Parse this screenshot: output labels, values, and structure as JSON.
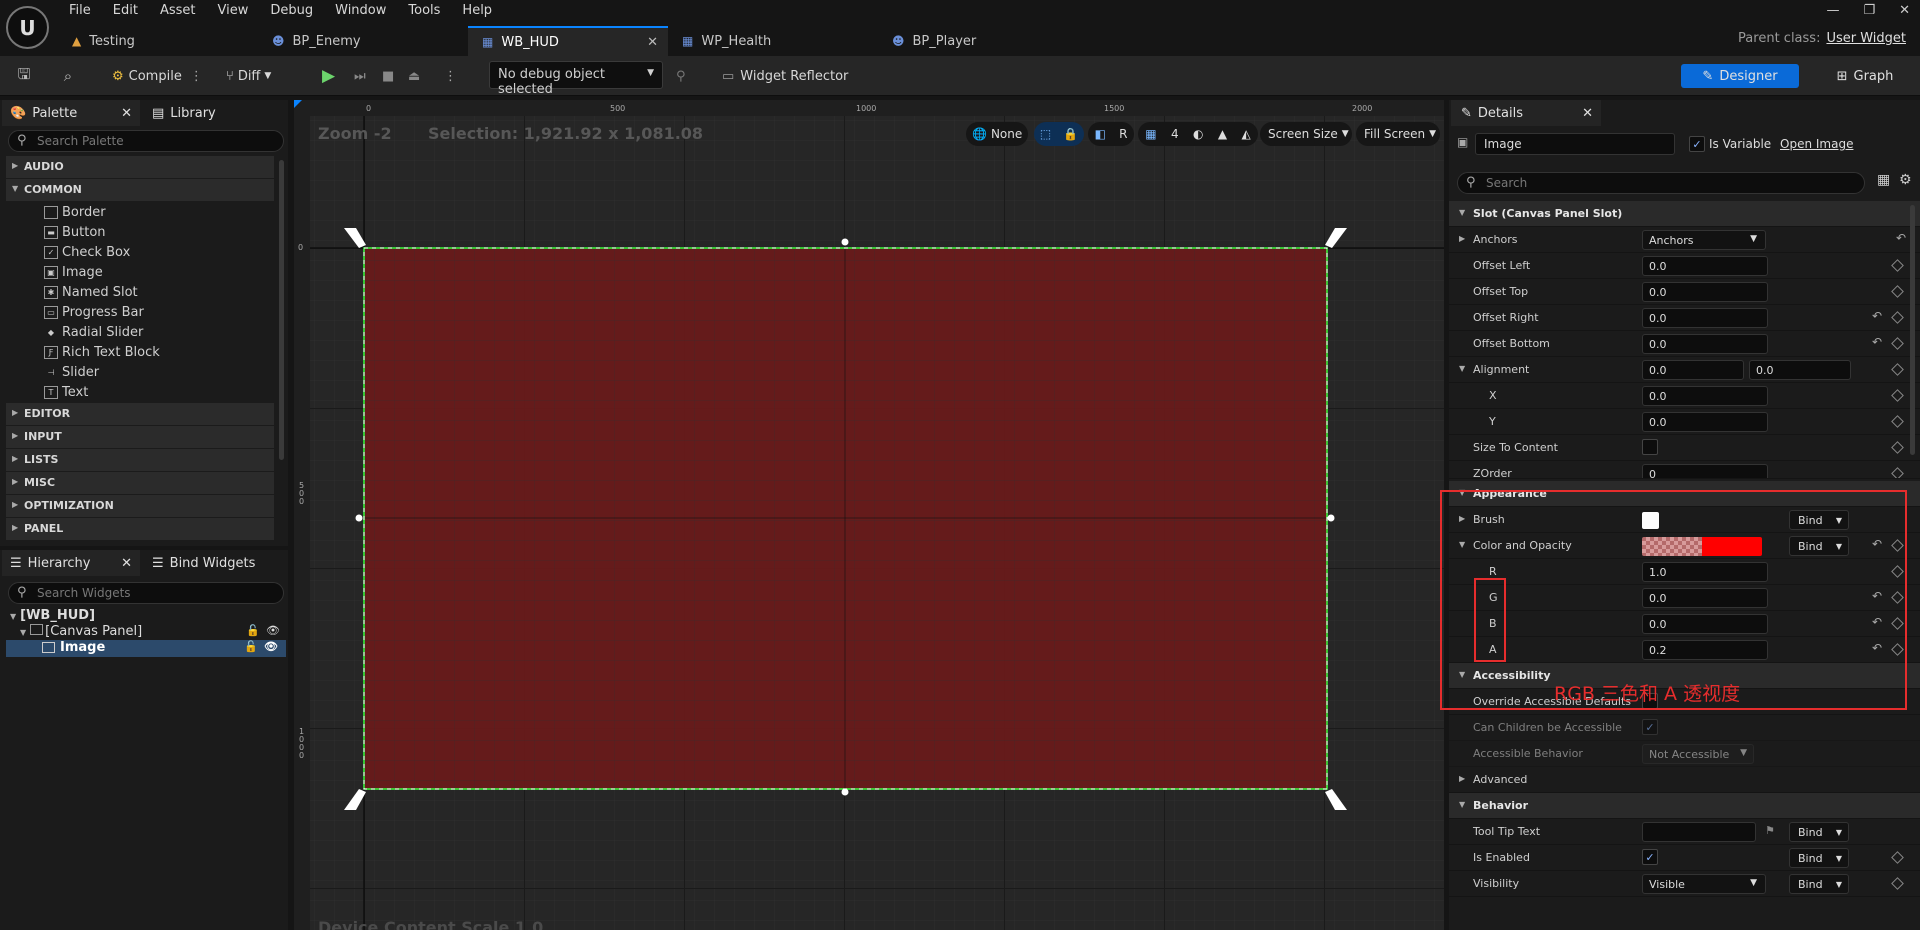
{
  "menu": [
    "File",
    "Edit",
    "Asset",
    "View",
    "Debug",
    "Window",
    "Tools",
    "Help"
  ],
  "tabs": [
    {
      "label": "Testing",
      "icon": "ue-icon",
      "active": false
    },
    {
      "label": "BP_Enemy",
      "icon": "person-icon",
      "active": false
    },
    {
      "label": "WB_HUD",
      "icon": "widget-icon",
      "active": true
    },
    {
      "label": "WP_Health",
      "icon": "widget-icon",
      "active": false
    },
    {
      "label": "BP_Player",
      "icon": "person-icon",
      "active": false
    }
  ],
  "parent_class": {
    "label": "Parent class:",
    "value": "User Widget"
  },
  "toolbar": {
    "compile": "Compile",
    "diff": "Diff",
    "debug_select": "No debug object selected",
    "widget_reflector": "Widget Reflector",
    "designer": "Designer",
    "graph": "Graph"
  },
  "palette": {
    "tab": "Palette",
    "library_tab": "Library",
    "search_placeholder": "Search Palette",
    "categories_top": [
      "AUDIO",
      "COMMON"
    ],
    "common_items": [
      "Border",
      "Button",
      "Check Box",
      "Image",
      "Named Slot",
      "Progress Bar",
      "Radial Slider",
      "Rich Text Block",
      "Slider",
      "Text"
    ],
    "categories_bottom": [
      "EDITOR",
      "INPUT",
      "LISTS",
      "MISC",
      "OPTIMIZATION",
      "PANEL"
    ]
  },
  "hierarchy": {
    "tab": "Hierarchy",
    "bind_tab": "Bind Widgets",
    "search_placeholder": "Search Widgets",
    "root": "[WB_HUD]",
    "canvas": "[Canvas Panel]",
    "image": "Image"
  },
  "viewport": {
    "zoom": "Zoom -2",
    "selection": "Selection: 1,921.92 x 1,081.08",
    "none_label": "None",
    "r_label": "R",
    "grid_value": "4",
    "screen_size": "Screen Size",
    "fill_screen": "Fill Screen",
    "ruler_top": [
      "0",
      "500",
      "1000",
      "1500",
      "2000"
    ],
    "ruler_left": [
      "0",
      "500",
      "1000"
    ],
    "dpi_text": "Device Content Scale 1.0",
    "fill_color": "#6a1a1a"
  },
  "details": {
    "tab": "Details",
    "name_value": "Image",
    "is_variable": "Is Variable",
    "open_image": "Open Image",
    "search_placeholder": "Search",
    "slot_section": "Slot (Canvas Panel Slot)",
    "anchors_label": "Anchors",
    "anchors_value": "Anchors",
    "offset_left": "Offset Left",
    "offset_left_v": "0.0",
    "offset_top": "Offset Top",
    "offset_top_v": "0.0",
    "offset_right": "Offset Right",
    "offset_right_v": "0.0",
    "offset_bottom": "Offset Bottom",
    "offset_bottom_v": "0.0",
    "alignment": "Alignment",
    "alignment_x": "0.0",
    "alignment_y": "0.0",
    "x_label": "X",
    "x_value": "0.0",
    "y_label": "Y",
    "y_value": "0.0",
    "size_to_content": "Size To Content",
    "zorder": "ZOrder",
    "zorder_v": "0",
    "appearance": "Appearance",
    "brush": "Brush",
    "color_opacity": "Color and Opacity",
    "bind": "Bind",
    "r_label": "R",
    "r_value": "1.0",
    "g_label": "G",
    "g_value": "0.0",
    "b_label": "B",
    "b_value": "0.0",
    "a_label": "A",
    "a_value": "0.2",
    "annotation": "RGB 三色和 A 透视度",
    "accessibility": "Accessibility",
    "override_access": "Override Accessible Defaults",
    "children_access": "Can Children be Accessible",
    "access_behavior": "Accessible Behavior",
    "access_behavior_v": "Not Accessible",
    "advanced": "Advanced",
    "behavior": "Behavior",
    "tooltip": "Tool Tip Text",
    "is_enabled": "Is Enabled",
    "visibility": "Visibility",
    "visibility_v": "Visible"
  },
  "colors": {
    "accent": "#0a84ff",
    "selection_green": "#3cff3c",
    "annotation_red": "#e62d2d",
    "tint_red": "#ff0000"
  }
}
